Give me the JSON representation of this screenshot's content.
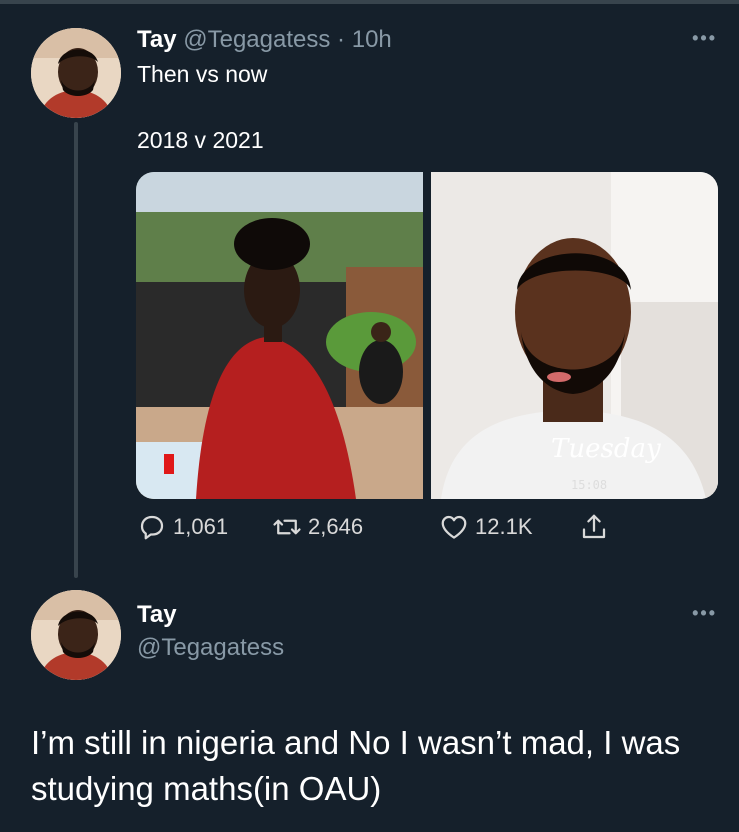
{
  "tweet1": {
    "name": "Tay",
    "handle": "@Tegagatess",
    "dot": "·",
    "time": "10h",
    "text_line1": "Then vs now",
    "text_line2": "2018 v 2021",
    "media": {
      "left_photo_icon": "photo-2018",
      "right_photo_icon": "photo-2021",
      "right_photo_overlay_text": "Tuesday",
      "right_photo_overlay_time": "15:08"
    },
    "actions": {
      "reply_count": "1,061",
      "retweet_count": "2,646",
      "like_count": "12.1K"
    }
  },
  "tweet2": {
    "name": "Tay",
    "handle": "@Tegagatess",
    "text": "I’m still in nigeria and No I wasn’t mad, I was studying maths(in OAU)"
  },
  "ui": {
    "more_label": "•••",
    "icons": [
      "more-icon",
      "reply-icon",
      "retweet-icon",
      "like-icon",
      "share-icon"
    ],
    "colors": {
      "background": "#15202b",
      "secondary_text": "#8899a6",
      "divider": "#38444d"
    }
  }
}
